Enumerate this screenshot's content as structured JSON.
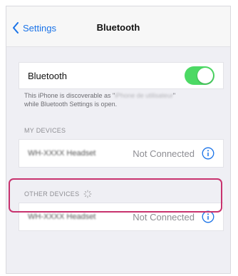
{
  "navbar": {
    "back_label": "Settings",
    "title": "Bluetooth"
  },
  "bluetooth_toggle": {
    "label": "Bluetooth",
    "state": "on",
    "color": "#4cd964"
  },
  "discoverable_note": {
    "line1_prefix": "This iPhone is discoverable as \"",
    "device_name_redacted": "iPhone de utilisateur",
    "line1_suffix": "\"",
    "line2": "while Bluetooth Settings is open."
  },
  "my_devices": {
    "header": "MY DEVICES",
    "items": [
      {
        "name": "WH-XXXX Headset",
        "status": "Not Connected",
        "icon": "info-icon"
      }
    ]
  },
  "other_devices": {
    "header": "OTHER DEVICES",
    "items": [
      {
        "name": "WH-XXXX Headset",
        "status": "Not Connected",
        "icon": "info-icon"
      }
    ]
  },
  "colors": {
    "accent": "#1a73e8",
    "highlight": "#c8326e",
    "background": "#efeff4"
  }
}
